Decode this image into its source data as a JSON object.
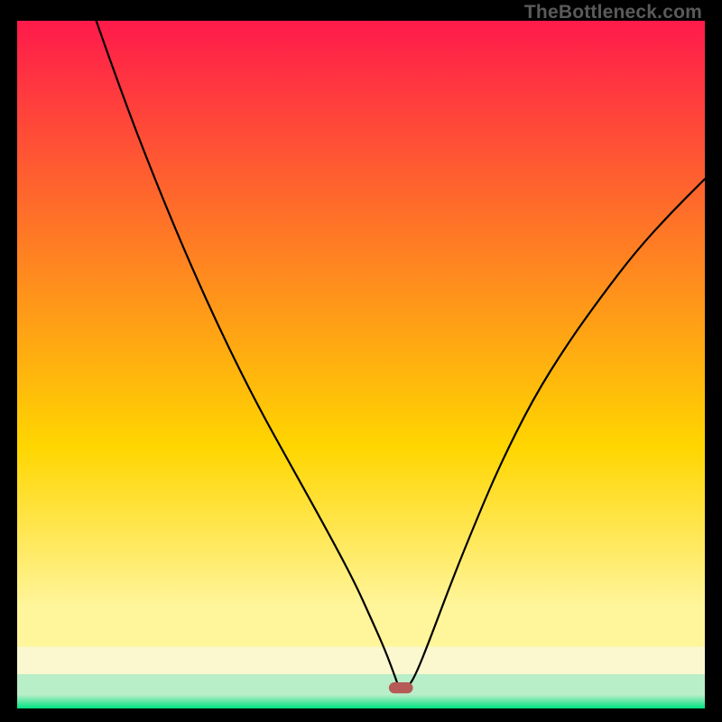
{
  "watermark": "TheBottleneck.com",
  "chart_data": {
    "type": "line",
    "title": "",
    "xlabel": "",
    "ylabel": "",
    "xlim": [
      0,
      100
    ],
    "ylim": [
      0,
      100
    ],
    "grid": false,
    "legend": false,
    "series": [
      {
        "name": "bottleneck-curve",
        "x_pct": [
          11.5,
          15,
          20,
          25,
          30,
          35,
          40,
          45,
          49,
          51.5,
          53.5,
          55,
          55.5,
          56.8,
          58,
          60,
          63,
          66,
          70,
          75,
          80,
          85,
          90,
          95,
          100
        ],
        "y_pct": [
          100,
          90,
          77,
          65,
          54,
          44,
          35,
          26,
          18.5,
          13,
          8.5,
          4.5,
          3,
          3,
          5,
          10,
          18,
          25.5,
          35,
          45,
          53,
          60,
          66.5,
          72,
          77
        ],
        "stroke": "#000000",
        "stroke_width": 2.2
      }
    ],
    "marker": {
      "name": "optimal-point-pill",
      "x_pct": 55.8,
      "y_pct": 3,
      "width_pct": 3.5,
      "height_pct": 1.6,
      "fill": "#b55a57"
    },
    "gradient_bands": {
      "top_color": "#ff1a4b",
      "mid_color": "#ffd600",
      "band1_color": "#fff59a",
      "band2_color": "#fbf8cf",
      "band3_color": "#b8eec8",
      "bottom_color": "#00e281"
    }
  }
}
